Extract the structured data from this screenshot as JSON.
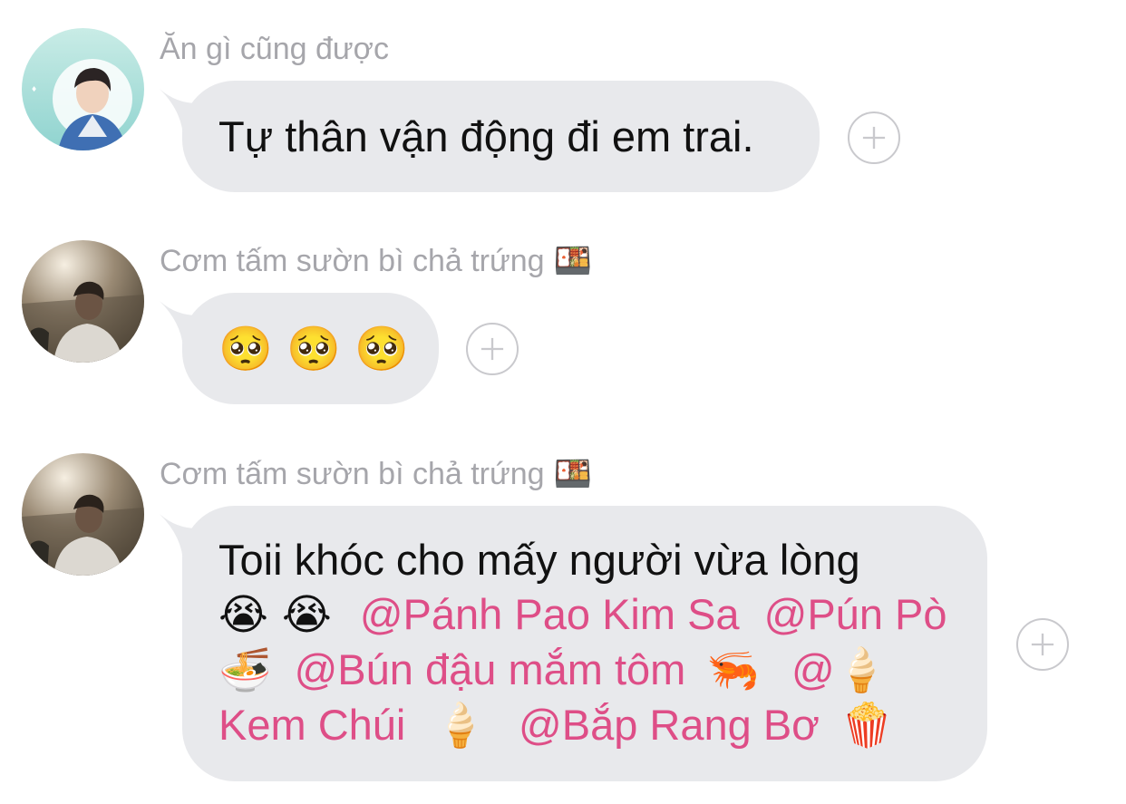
{
  "messages": [
    {
      "sender": "Ăn gì cũng được",
      "sender_emoji": "",
      "text": "Tự thân vận động đi em trai.",
      "avatar": "avatar-portrait-teal",
      "react_icon": "plus-circle-icon"
    },
    {
      "sender": "Cơm tấm sườn bì chả trứng",
      "sender_emoji": "🍱",
      "text": "🥺 🥺 🥺",
      "avatar": "avatar-portrait-sunset",
      "react_icon": "plus-circle-icon"
    },
    {
      "sender": "Cơm tấm sườn bì chả trứng",
      "sender_emoji": "🍱",
      "line1": "Toii khóc cho mấy người vừa lòng",
      "line2_emoji": "😭 😭",
      "mentions": {
        "m1": "@Pánh Pao Kim Sa",
        "m2": "@Pún Pò",
        "m2_emoji": "🍜",
        "m3": "@Bún đậu mắm tôm",
        "m3_emoji": "🦐",
        "m4_at": "@",
        "m4_emoji": "🍦",
        "m4_name": "Kem Chúi",
        "m4_emoji2": "🍦",
        "m5": "@Bắp Rang Bơ",
        "m5_emoji": "🍿"
      },
      "avatar": "avatar-portrait-sunset",
      "react_icon": "plus-circle-icon"
    }
  ],
  "colors": {
    "bubble": "#e8e9ec",
    "mention": "#de4e87",
    "sender": "#a6a6ab",
    "react_border": "#c9c9cd"
  }
}
